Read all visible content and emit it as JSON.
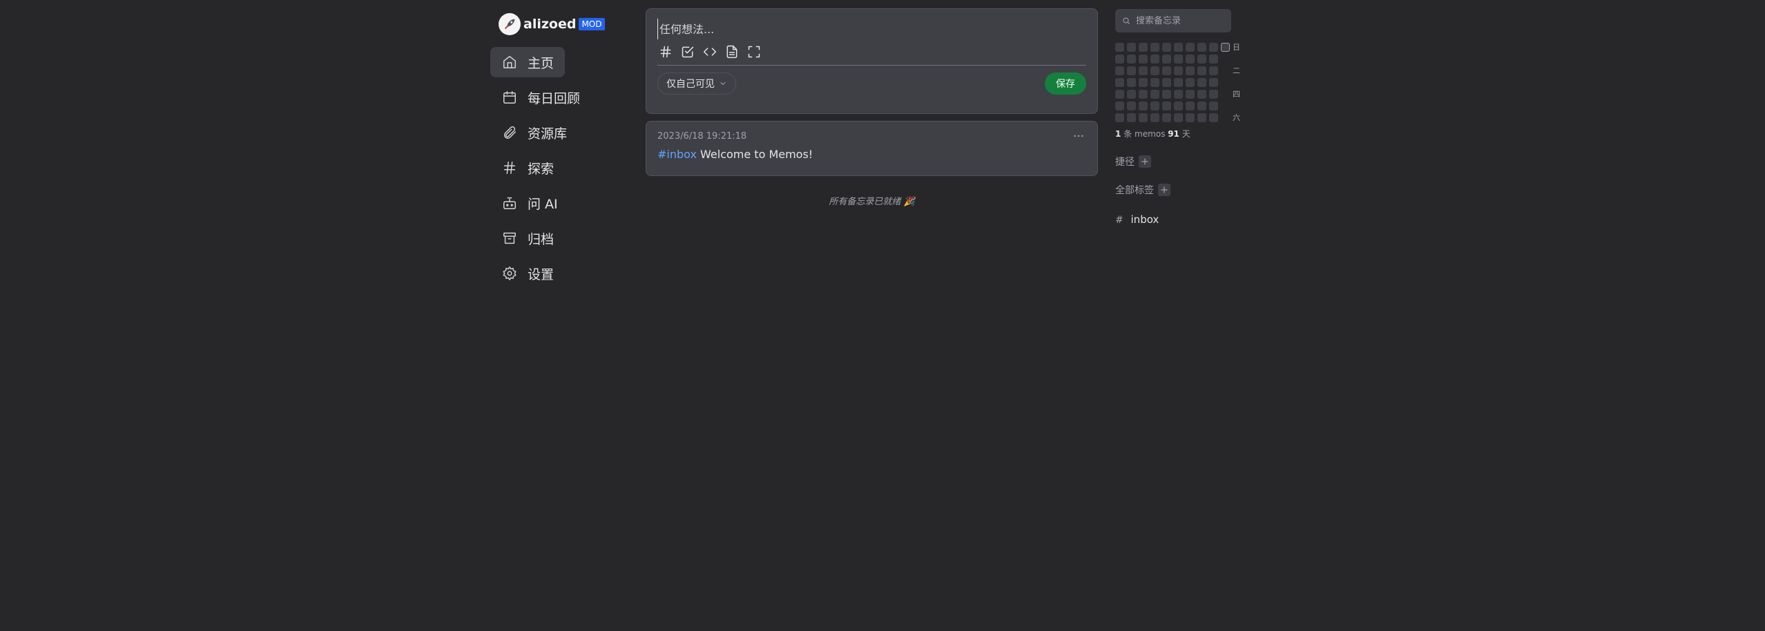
{
  "brand": {
    "name": "alizoed",
    "badge": "MOD"
  },
  "nav": {
    "items": [
      {
        "label": "主页",
        "icon": "home-icon",
        "active": true
      },
      {
        "label": "每日回顾",
        "icon": "calendar-icon",
        "active": false
      },
      {
        "label": "资源库",
        "icon": "paperclip-icon",
        "active": false
      },
      {
        "label": "探索",
        "icon": "hash-icon",
        "active": false
      },
      {
        "label": "问 AI",
        "icon": "bot-icon",
        "active": false
      },
      {
        "label": "归档",
        "icon": "archive-icon",
        "active": false
      },
      {
        "label": "设置",
        "icon": "gear-icon",
        "active": false
      }
    ]
  },
  "editor": {
    "placeholder": "任何想法...",
    "visibility": "仅自己可见",
    "save_label": "保存",
    "tools": [
      "hash-icon",
      "checkbox-icon",
      "code-icon",
      "file-icon",
      "fullscreen-icon"
    ]
  },
  "memos": [
    {
      "time": "2023/6/18 19:21:18",
      "tag": "#inbox",
      "text": "Welcome to Memos!"
    }
  ],
  "end_note": "所有备忘录已就绪 🎉",
  "sidebar_right": {
    "search_placeholder": "搜索备忘录",
    "weekdays": [
      "日",
      "",
      "二",
      "",
      "四",
      "",
      "六"
    ],
    "stats": {
      "memo_count": "1",
      "memo_unit": "条 memos",
      "days_count": "91",
      "days_unit": "天"
    },
    "shortcuts_label": "捷径",
    "tags_label": "全部标签",
    "tags": [
      {
        "hash": "#",
        "name": "inbox"
      }
    ]
  },
  "colors": {
    "background": "#27272a",
    "card": "#3f3f46",
    "accent_tag": "#60a5fa",
    "save_button": "#15803d",
    "mod_badge": "#2563eb"
  }
}
